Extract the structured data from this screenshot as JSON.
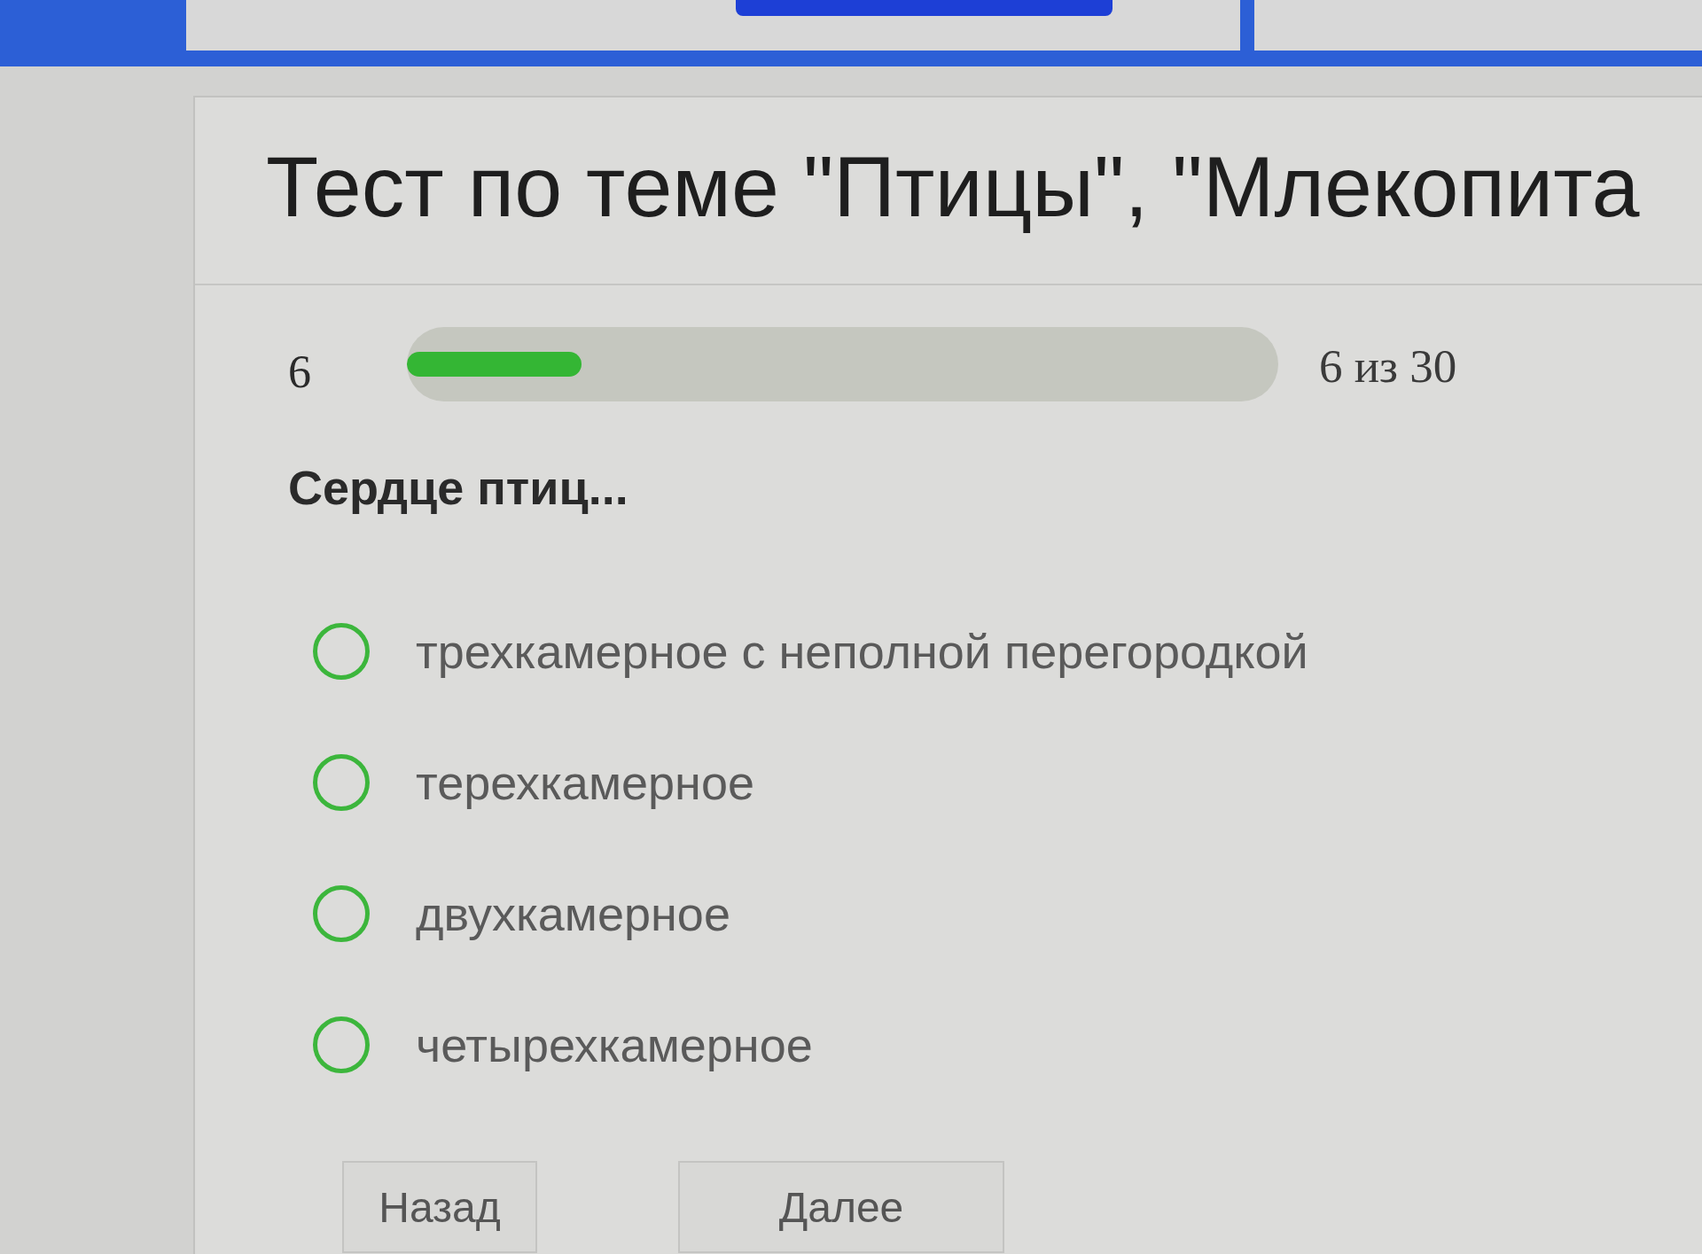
{
  "test": {
    "title": "Тест по теме \"Птицы\", \"Млекопита",
    "progress": {
      "number": "6",
      "level": 0.2,
      "reading": "6 из 30"
    },
    "question": "Сердце птиц...",
    "options": [
      {
        "label": "трехкамерное с неполной перегородкой",
        "selected": false
      },
      {
        "label": "терехкамерное",
        "selected": false
      },
      {
        "label": "двухкамерное",
        "selected": false
      },
      {
        "label": "четырехкамерное",
        "selected": false
      }
    ],
    "buttons": [
      "Назад",
      "Далее"
    ]
  }
}
